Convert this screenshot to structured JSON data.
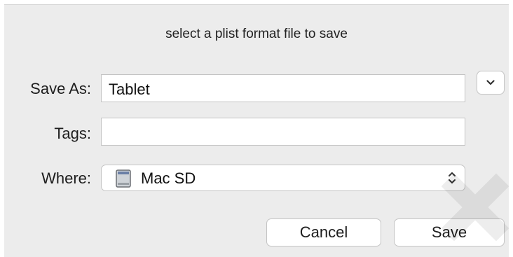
{
  "dialog": {
    "title": "select a plist format file to save"
  },
  "save_as": {
    "label": "Save As:",
    "value": "Tablet"
  },
  "tags": {
    "label": "Tags:",
    "value": ""
  },
  "where": {
    "label": "Where:",
    "value": "Mac SD",
    "icon": "drive-icon"
  },
  "buttons": {
    "cancel": "Cancel",
    "save": "Save"
  },
  "icons": {
    "expand": "chevron-down-icon",
    "popup": "up-down-arrows-icon"
  }
}
